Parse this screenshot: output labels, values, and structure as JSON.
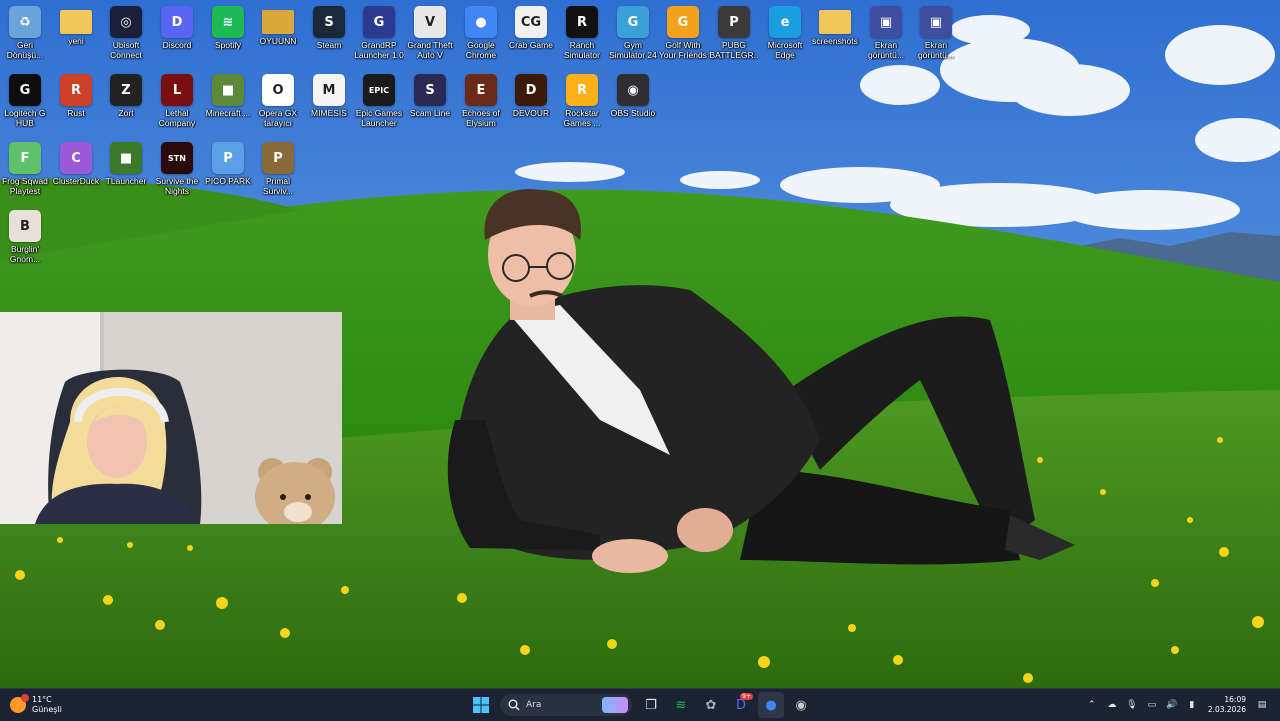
{
  "desktop": {
    "icons": [
      {
        "label": "Geri Dönüşü...",
        "icon": "recycle-bin-icon",
        "color": "#6aa4d8",
        "glyph": "♻"
      },
      {
        "label": "yeni",
        "icon": "folder-icon",
        "color": "#f1c75a",
        "glyph": ""
      },
      {
        "label": "Ubisoft Connect",
        "icon": "ubisoft-icon",
        "color": "#1b1f3a",
        "glyph": "◎"
      },
      {
        "label": "Discord",
        "icon": "discord-icon",
        "color": "#5865f2",
        "glyph": "D"
      },
      {
        "label": "Spotify",
        "icon": "spotify-icon",
        "color": "#1db954",
        "glyph": "≋"
      },
      {
        "label": "OYUUNN",
        "icon": "folder-icon",
        "color": "#d8a83a",
        "glyph": ""
      },
      {
        "label": "Steam",
        "icon": "steam-icon",
        "color": "#1b2838",
        "glyph": "S"
      },
      {
        "label": "GrandRP Launcher 1.0",
        "icon": "grandrp-icon",
        "color": "#2c3b8f",
        "glyph": "G"
      },
      {
        "label": "Grand Theft Auto V",
        "icon": "gta-v-icon",
        "color": "#e8e8e8",
        "glyph": "V"
      },
      {
        "label": "Google Chrome",
        "icon": "chrome-icon",
        "color": "#4285f4",
        "glyph": "●"
      },
      {
        "label": "Crab Game",
        "icon": "crab-game-icon",
        "color": "#f0f0f0",
        "glyph": "CG"
      },
      {
        "label": "Ranch Simulator",
        "icon": "ranch-simulator-icon",
        "color": "#111111",
        "glyph": "R"
      },
      {
        "label": "Gym Simulator 24",
        "icon": "gym-simulator-icon",
        "color": "#3aa0d8",
        "glyph": "G"
      },
      {
        "label": "Golf With Your Friends",
        "icon": "golf-icon",
        "color": "#f2a21c",
        "glyph": "G"
      },
      {
        "label": "PUBG BATTLEGR...",
        "icon": "pubg-icon",
        "color": "#3a3a3a",
        "glyph": "P"
      },
      {
        "label": "Microsoft Edge",
        "icon": "edge-icon",
        "color": "#1b9de2",
        "glyph": "e"
      },
      {
        "label": "screenshots",
        "icon": "folder-icon",
        "color": "#f1c75a",
        "glyph": ""
      },
      {
        "label": "Ekran görüntü...",
        "icon": "screenshot-icon",
        "color": "#3f4ea0",
        "glyph": "▣"
      },
      {
        "label": "Ekran görüntü...",
        "icon": "screenshot-icon",
        "color": "#3f4ea0",
        "glyph": "▣"
      },
      {
        "label": "Logitech G HUB",
        "icon": "logitech-icon",
        "color": "#0d0d0d",
        "glyph": "G"
      },
      {
        "label": "Rust",
        "icon": "rust-icon",
        "color": "#cd412b",
        "glyph": "R"
      },
      {
        "label": "Zort",
        "icon": "zort-icon",
        "color": "#222222",
        "glyph": "Z"
      },
      {
        "label": "Lethal Company",
        "icon": "lethal-company-icon",
        "color": "#7a0f0f",
        "glyph": "L"
      },
      {
        "label": "Minecraft ...",
        "icon": "minecraft-icon",
        "color": "#5d8a3a",
        "glyph": "■"
      },
      {
        "label": "Opera GX tarayıcı",
        "icon": "opera-gx-icon",
        "color": "#ffffff",
        "glyph": "O"
      },
      {
        "label": "MIMESIS",
        "icon": "mimesis-icon",
        "color": "#f5f5f5",
        "glyph": "M"
      },
      {
        "label": "Epic Games Launcher",
        "icon": "epic-games-icon",
        "color": "#1a1a1a",
        "glyph": "EPIC"
      },
      {
        "label": "Scam Line",
        "icon": "scam-line-icon",
        "color": "#2a2a55",
        "glyph": "S"
      },
      {
        "label": "Echoes of Elysium",
        "icon": "echoes-icon",
        "color": "#6b2a18",
        "glyph": "E"
      },
      {
        "label": "DEVOUR",
        "icon": "devour-icon",
        "color": "#3b1a0a",
        "glyph": "D"
      },
      {
        "label": "Rockstar Games ...",
        "icon": "rockstar-icon",
        "color": "#fcaf17",
        "glyph": "R"
      },
      {
        "label": "OBS Studio",
        "icon": "obs-icon",
        "color": "#302e31",
        "glyph": "◉"
      },
      {
        "label": "Frog Sqwad Playtest",
        "icon": "frog-icon",
        "color": "#5fc16a",
        "glyph": "F"
      },
      {
        "label": "ClusterDuck",
        "icon": "clusterduck-icon",
        "color": "#9a5ad8",
        "glyph": "C"
      },
      {
        "label": "TLauncher",
        "icon": "tlauncher-icon",
        "color": "#3a7a2a",
        "glyph": "■"
      },
      {
        "label": "Survive the Nights",
        "icon": "survive-nights-icon",
        "color": "#2a0a0a",
        "glyph": "STN"
      },
      {
        "label": "PICO PARK",
        "icon": "pico-park-icon",
        "color": "#5aa0e8",
        "glyph": "P"
      },
      {
        "label": "Primal Surviv...",
        "icon": "primal-survival-icon",
        "color": "#8a6a3a",
        "glyph": "P"
      },
      {
        "label": "Burglin' Gnom...",
        "icon": "burglin-gnomes-icon",
        "color": "#e8e0d8",
        "glyph": "B"
      }
    ]
  },
  "taskbar": {
    "weather": {
      "temp": "11°C",
      "condition": "Güneşli",
      "icon": "weather-sun-icon",
      "accent": "#ff9a2a"
    },
    "search": {
      "placeholder": "Ara"
    },
    "apps": [
      {
        "name": "task-view-icon",
        "glyph": "❐"
      },
      {
        "name": "spotify-icon",
        "glyph": "≋",
        "color": "#1db954"
      },
      {
        "name": "settings-icon",
        "glyph": "✿",
        "color": "#9ab0c8"
      },
      {
        "name": "discord-icon",
        "glyph": "D",
        "color": "#5865f2",
        "badge": "9+"
      },
      {
        "name": "chrome-icon",
        "glyph": "●",
        "color": "#4285f4"
      },
      {
        "name": "obs-icon",
        "glyph": "◉",
        "color": "#c8c8c8"
      }
    ],
    "tray": {
      "time": "16:09",
      "date": "2.03.2026"
    }
  }
}
